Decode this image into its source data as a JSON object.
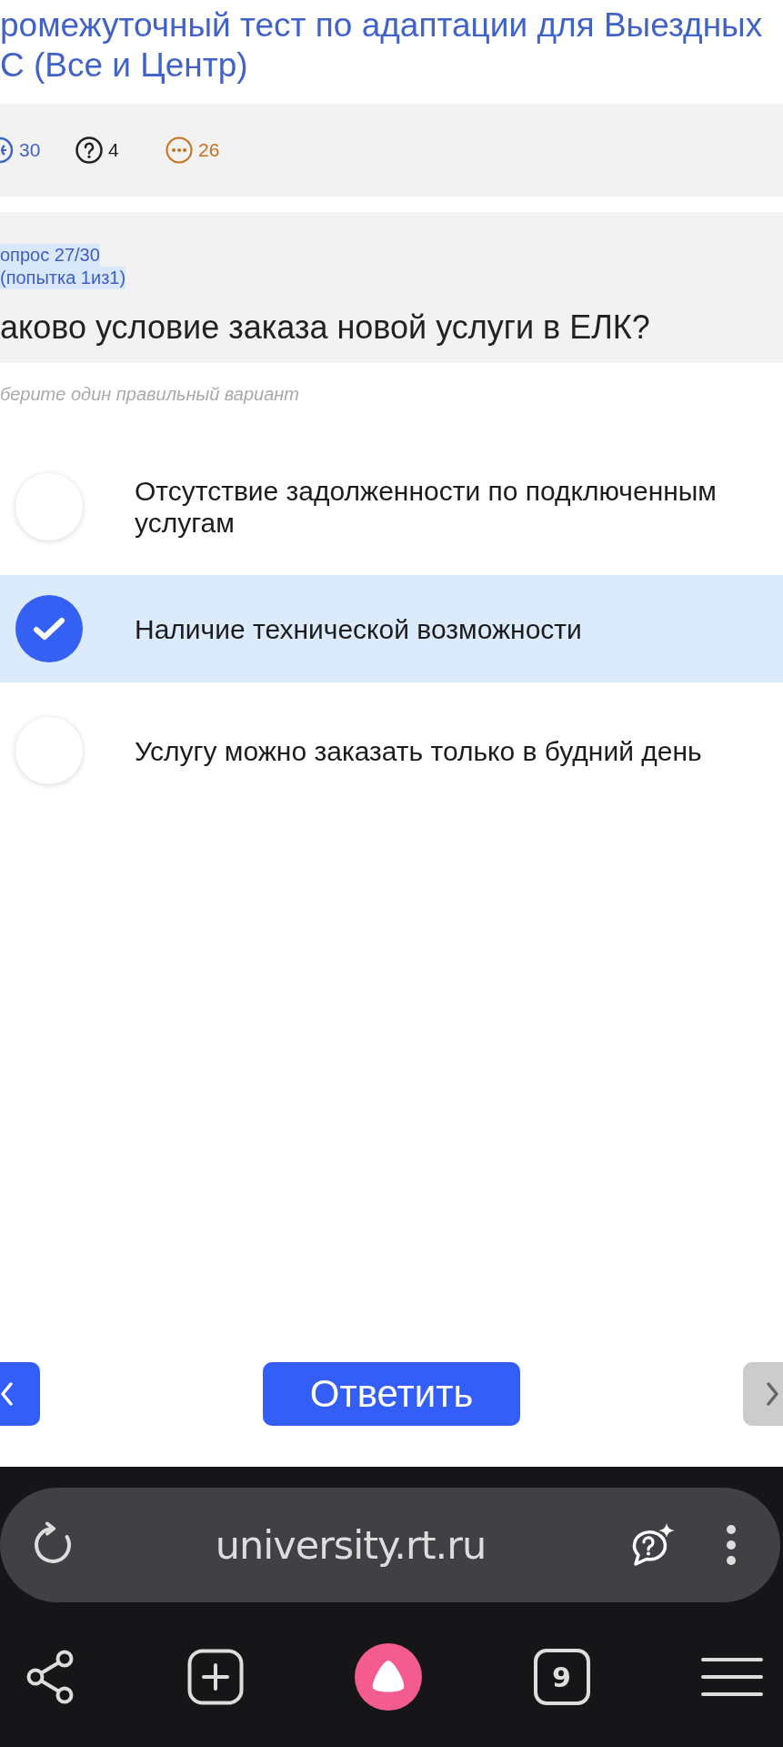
{
  "header": {
    "title_lines": [
      "ромежуточный тест по адаптации для Выездных",
      "С (Все и Центр)"
    ]
  },
  "stats": [
    {
      "kind": "ring",
      "count": "30"
    },
    {
      "kind": "question",
      "count": "4"
    },
    {
      "kind": "dots",
      "count": "26"
    }
  ],
  "question": {
    "counter": "опрос 27/30",
    "attempt": "(попытка 1из1)",
    "highlighted": true,
    "text": "аково условие заказа новой услуги в ЕЛК?",
    "hint": "берите один правильный вариант"
  },
  "options": [
    {
      "label": "Отсутствие задолженности по подключенным услугам",
      "selected": false
    },
    {
      "label": "Наличие технической возможности",
      "selected": true
    },
    {
      "label": "Услугу можно заказать только в будний день",
      "selected": false
    }
  ],
  "nav_buttons": [
    {
      "kind": "prev",
      "disabled": false
    },
    {
      "kind": "submit",
      "label": "Ответить",
      "disabled": false
    },
    {
      "kind": "next",
      "disabled": true
    }
  ],
  "browser": {
    "url": "university.rt.ru",
    "tab_count": "9"
  }
}
